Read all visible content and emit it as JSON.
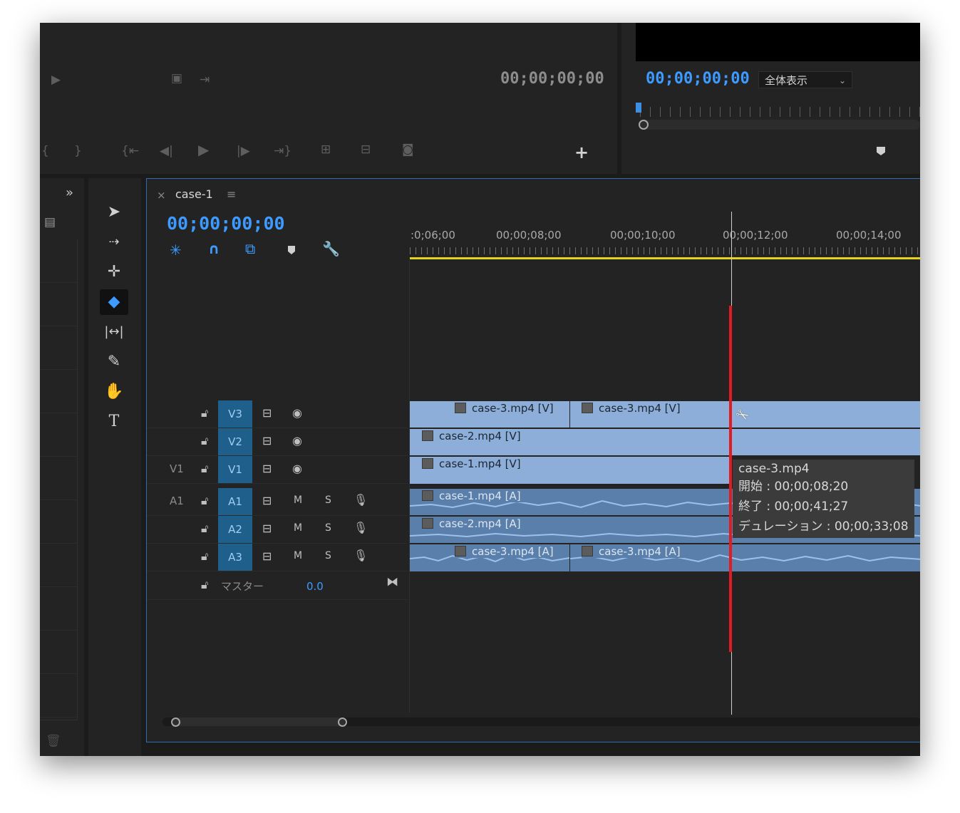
{
  "source_monitor": {
    "timecode": "00;00;00;00"
  },
  "program_monitor": {
    "timecode": "00;00;00;00",
    "zoom_select": "全体表示"
  },
  "timeline": {
    "tab_title": "case-1",
    "tab_close": "×",
    "tab_menu": "≡",
    "timecode": "00;00;00;00",
    "ruler_labels": [
      ":0;06;00",
      "00;00;08;00",
      "00;00;10;00",
      "00;00;12;00",
      "00;00;14;00"
    ],
    "video_tracks": [
      {
        "source_patch": "",
        "name": "V3"
      },
      {
        "source_patch": "",
        "name": "V2"
      },
      {
        "source_patch": "V1",
        "name": "V1"
      }
    ],
    "audio_tracks": [
      {
        "source_patch": "A1",
        "name": "A1",
        "mute": "M",
        "solo": "S"
      },
      {
        "source_patch": "",
        "name": "A2",
        "mute": "M",
        "solo": "S"
      },
      {
        "source_patch": "",
        "name": "A3",
        "mute": "M",
        "solo": "S"
      }
    ],
    "master": {
      "label": "マスター",
      "value": "0.0"
    },
    "clips": {
      "v3a": "case-3.mp4 [V]",
      "v3b": "case-3.mp4 [V]",
      "v2": "case-2.mp4 [V]",
      "v1": "case-1.mp4 [V]",
      "a1": "case-1.mp4 [A]",
      "a2": "case-2.mp4 [A]",
      "a3a": "case-3.mp4 [A]",
      "a3b": "case-3.mp4 [A]"
    },
    "tooltip": {
      "name": "case-3.mp4",
      "start": "開始 : 00;00;08;20",
      "end": "終了 : 00;00;41;27",
      "duration": "デュレーション : 00;00;33;08"
    }
  },
  "colors": {
    "accent": "#3d9bff",
    "clip_video": "#8caed8",
    "clip_audio": "#5a7faa",
    "playhead": "#e11b22",
    "work_area": "#e5d21b"
  }
}
